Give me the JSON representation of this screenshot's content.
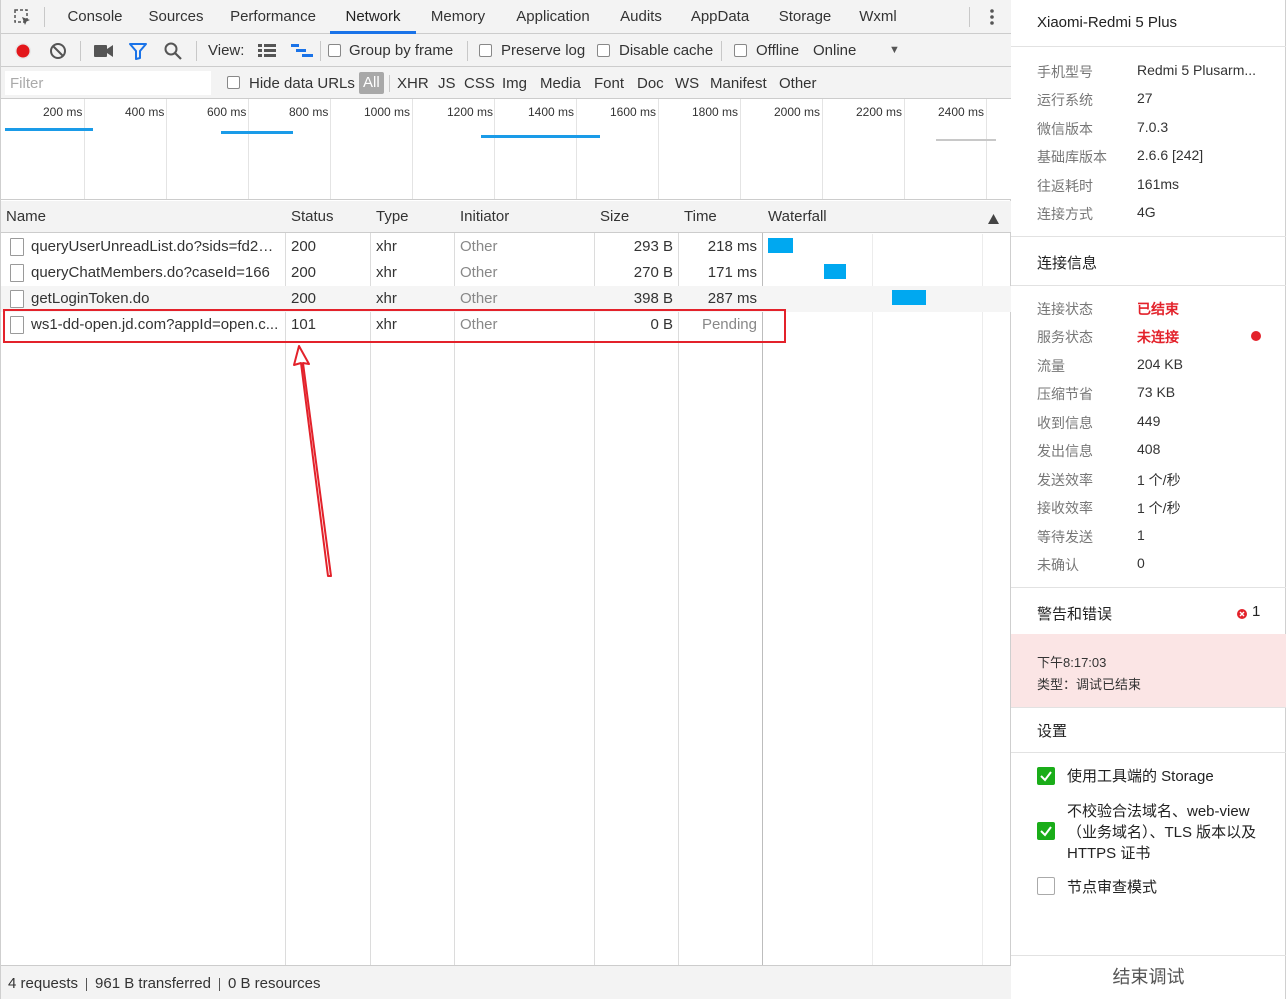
{
  "tabs": [
    "Console",
    "Sources",
    "Performance",
    "Network",
    "Memory",
    "Application",
    "Audits",
    "AppData",
    "Storage",
    "Wxml"
  ],
  "active_tab": "Network",
  "toolbar": {
    "view_label": "View:",
    "group_by_frame": "Group by frame",
    "preserve_log": "Preserve log",
    "disable_cache": "Disable cache",
    "offline": "Offline",
    "throttle_value": "Online"
  },
  "filterbar": {
    "placeholder": "Filter",
    "hide_data_urls": "Hide data URLs",
    "types": [
      "All",
      "XHR",
      "JS",
      "CSS",
      "Img",
      "Media",
      "Font",
      "Doc",
      "WS",
      "Manifest",
      "Other"
    ],
    "active_type": "All"
  },
  "overview": {
    "ticks": [
      "200 ms",
      "400 ms",
      "600 ms",
      "800 ms",
      "1000 ms",
      "1200 ms",
      "1400 ms",
      "1600 ms",
      "1800 ms",
      "2000 ms",
      "2200 ms",
      "2400 ms"
    ]
  },
  "columns": [
    "Name",
    "Status",
    "Type",
    "Initiator",
    "Size",
    "Time",
    "Waterfall"
  ],
  "requests": [
    {
      "name": "queryUserUnreadList.do?sids=fd22f...",
      "status": "200",
      "type": "xhr",
      "initiator": "Other",
      "size": "293 B",
      "time": "218 ms"
    },
    {
      "name": "queryChatMembers.do?caseId=166",
      "status": "200",
      "type": "xhr",
      "initiator": "Other",
      "size": "270 B",
      "time": "171 ms"
    },
    {
      "name": "getLoginToken.do",
      "status": "200",
      "type": "xhr",
      "initiator": "Other",
      "size": "398 B",
      "time": "287 ms"
    },
    {
      "name": "ws1-dd-open.jd.com?appId=open.c...",
      "status": "101",
      "type": "xhr",
      "initiator": "Other",
      "size": "0 B",
      "time": "Pending"
    }
  ],
  "statusbar": {
    "requests": "4 requests",
    "transferred": "961 B transferred",
    "resources": "0 B resources"
  },
  "side": {
    "device_title": "Xiaomi-Redmi 5 Plus",
    "device_info": [
      {
        "key": "手机型号",
        "value": "Redmi 5 Plusarm..."
      },
      {
        "key": "运行系统",
        "value": "27"
      },
      {
        "key": "微信版本",
        "value": "7.0.3"
      },
      {
        "key": "基础库版本",
        "value": "2.6.6 [242]"
      },
      {
        "key": "往返耗时",
        "value": "161ms"
      },
      {
        "key": "连接方式",
        "value": "4G"
      }
    ],
    "conn_title": "连接信息",
    "conn_info": [
      {
        "key": "连接状态",
        "value": "已结束"
      },
      {
        "key": "服务状态",
        "value": "未连接"
      },
      {
        "key": "流量",
        "value": "204 KB"
      },
      {
        "key": "压缩节省",
        "value": "73 KB"
      },
      {
        "key": "收到信息",
        "value": "449"
      },
      {
        "key": "发出信息",
        "value": "408"
      },
      {
        "key": "发送效率",
        "value": "1 个/秒"
      },
      {
        "key": "接收效率",
        "value": "1 个/秒"
      },
      {
        "key": "等待发送",
        "value": "1"
      },
      {
        "key": "未确认",
        "value": "0"
      }
    ],
    "warn_title": "警告和错误",
    "warn_count": "1",
    "error_time": "下午8:17:03",
    "error_type": "类型：调试已结束",
    "settings_title": "设置",
    "settings": [
      {
        "label": "使用工具端的 Storage",
        "checked": true
      },
      {
        "label": "不校验合法域名、web-view（业务域名）、TLS 版本以及 HTTPS 证书",
        "checked": true
      },
      {
        "label": "节点审查模式",
        "checked": false
      }
    ],
    "end_debug": "结束调试"
  },
  "colors": {
    "accent": "#1a73e8",
    "waterfall_bar": "#00a8f0",
    "highlight": "#e3222b",
    "success_check": "#1aad19",
    "error_bg": "#fbe5e5"
  }
}
